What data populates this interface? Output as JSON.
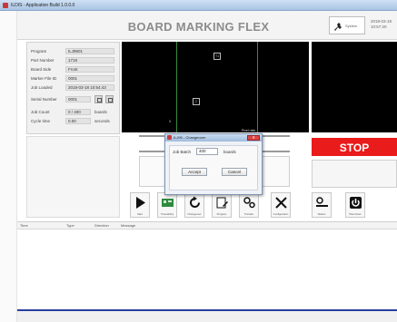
{
  "window": {
    "title": "ILDIS - Application Build 1.0.0.0"
  },
  "header": {
    "title": "BOARD MARKING FLEX",
    "system_label": "System",
    "date": "2018-03-18",
    "time": "10:57:20"
  },
  "info": {
    "rows": [
      {
        "label": "Program",
        "value": "ILJ9601"
      },
      {
        "label": "Part Number",
        "value": "1719"
      },
      {
        "label": "Board Side",
        "value": "Front"
      },
      {
        "label": "Marker File ID",
        "value": "0001"
      },
      {
        "label": "Job Loaded",
        "value": "2018-03-18 10:54:43"
      },
      {
        "label": "Serial Number",
        "value": "0001"
      },
      {
        "label": "Job Count",
        "value": "0 / 400",
        "unit": "boards"
      },
      {
        "label": "Cycle time",
        "value": "0.00",
        "unit": "seconds"
      }
    ]
  },
  "camera": {
    "mark_top": "T1",
    "mark_mid": "2",
    "corner_label": "X",
    "pixel_label": "Pixel ratio"
  },
  "stop": {
    "label": "STOP"
  },
  "toolbar": [
    {
      "name": "start",
      "label": "Start"
    },
    {
      "name": "traceability",
      "label": "Traceability"
    },
    {
      "name": "changeover",
      "label": "Changeover"
    },
    {
      "name": "program",
      "label": "Program"
    },
    {
      "name": "transfer",
      "label": "Transfer"
    },
    {
      "name": "configuration",
      "label": "Configuration"
    },
    {
      "name": "station",
      "label": "Station"
    },
    {
      "name": "shut-down",
      "label": "Shut Down"
    }
  ],
  "log": {
    "columns": [
      "Time",
      "Type",
      "Direction",
      "Message"
    ]
  },
  "dialog": {
    "title": "ILJ99 - Changeover",
    "field_label": "Job Batch",
    "field_value": "400",
    "unit": "boards",
    "accept": "Accept",
    "cancel": "Cancel"
  },
  "colors": {
    "stop": "#ea1b1b",
    "accent_line": "#2a3fa0",
    "title_text": "#8c8c8c"
  }
}
